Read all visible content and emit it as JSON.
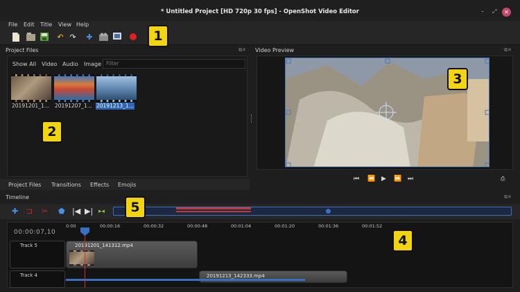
{
  "window": {
    "title": "* Untitled Project [HD 720p 30 fps] - OpenShot Video Editor",
    "minimize": "–",
    "maximize": "⤢",
    "close": "✕"
  },
  "menu": [
    "File",
    "Edit",
    "Title",
    "View",
    "Help"
  ],
  "toolbar_icons": [
    "new-project-icon",
    "open-project-icon",
    "save-project-icon",
    "undo-icon",
    "redo-icon",
    "import-files-icon",
    "profile-icon",
    "fullscreen-icon",
    "export-video-icon"
  ],
  "callouts": {
    "c1": "1",
    "c2": "2",
    "c3": "3",
    "c4": "4",
    "c5": "5"
  },
  "project_files": {
    "title": "Project Files",
    "filter_tabs": [
      "Show All",
      "Video",
      "Audio",
      "Image"
    ],
    "filter_placeholder": "Filter",
    "files": [
      {
        "label": "20191201_1...",
        "selected": false
      },
      {
        "label": "20191207_1...",
        "selected": false
      },
      {
        "label": "20191213_1...",
        "selected": true
      }
    ]
  },
  "video_preview": {
    "title": "Video Preview",
    "controls": [
      "jump-start-icon",
      "rewind-icon",
      "play-icon",
      "fast-forward-icon",
      "jump-end-icon"
    ]
  },
  "bottom_tabs": [
    "Project Files",
    "Transitions",
    "Effects",
    "Emojis"
  ],
  "timeline": {
    "title": "Timeline",
    "timecode": "00:00:07,10",
    "ruler": [
      "0:00",
      "00:00:16",
      "00:00:32",
      "00:00:48",
      "00:01:04",
      "00:01:20",
      "00:01:36",
      "00:01:52"
    ],
    "tools": [
      "add-track-icon",
      "snapping-icon",
      "razor-icon",
      "add-marker-icon",
      "previous-marker-icon",
      "next-marker-icon",
      "center-playhead-icon"
    ],
    "tracks": [
      {
        "name": "Track 5",
        "clip": "20191201_141312.mp4"
      },
      {
        "name": "Track 4",
        "clip": "20191213_142333.mp4"
      }
    ]
  },
  "colors": {
    "accent": "#3a6fc2",
    "callout": "#f2d410",
    "record": "#e02020"
  }
}
